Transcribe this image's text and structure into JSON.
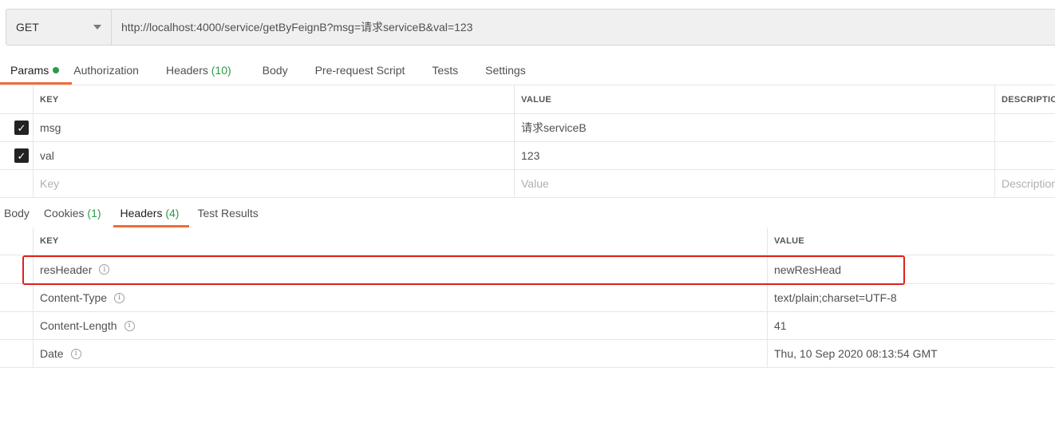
{
  "request": {
    "method": "GET",
    "url": "http://localhost:4000/service/getByFeignB?msg=请求serviceB&val=123"
  },
  "request_tabs": [
    {
      "label": "Params",
      "count": "",
      "active": true,
      "dot": true
    },
    {
      "label": "Authorization",
      "count": ""
    },
    {
      "label": "Headers",
      "count": "(10)"
    },
    {
      "label": "Body",
      "count": ""
    },
    {
      "label": "Pre-request Script",
      "count": ""
    },
    {
      "label": "Tests",
      "count": ""
    },
    {
      "label": "Settings",
      "count": ""
    }
  ],
  "params": {
    "headers": {
      "key": "KEY",
      "value": "VALUE",
      "description": "DESCRIPTION"
    },
    "rows": [
      {
        "checked": true,
        "key": "msg",
        "value": "请求serviceB",
        "description": ""
      },
      {
        "checked": true,
        "key": "val",
        "value": "123",
        "description": ""
      }
    ],
    "placeholder": {
      "key": "Key",
      "value": "Value",
      "description": "Description"
    }
  },
  "response_tabs": [
    {
      "label": "Body",
      "count": ""
    },
    {
      "label": "Cookies",
      "count": "(1)"
    },
    {
      "label": "Headers",
      "count": "(4)",
      "active": true
    },
    {
      "label": "Test Results",
      "count": ""
    }
  ],
  "response_headers": {
    "columns": {
      "key": "KEY",
      "value": "VALUE"
    },
    "rows": [
      {
        "key": "resHeader",
        "value": "newResHead",
        "highlighted": true
      },
      {
        "key": "Content-Type",
        "value": "text/plain;charset=UTF-8"
      },
      {
        "key": "Content-Length",
        "value": "41"
      },
      {
        "key": "Date",
        "value": "Thu, 10 Sep 2020 08:13:54 GMT"
      }
    ]
  },
  "colors": {
    "accent": "#f26b3a",
    "count_green": "#2b9a4a",
    "highlight_red": "#e0201a"
  }
}
